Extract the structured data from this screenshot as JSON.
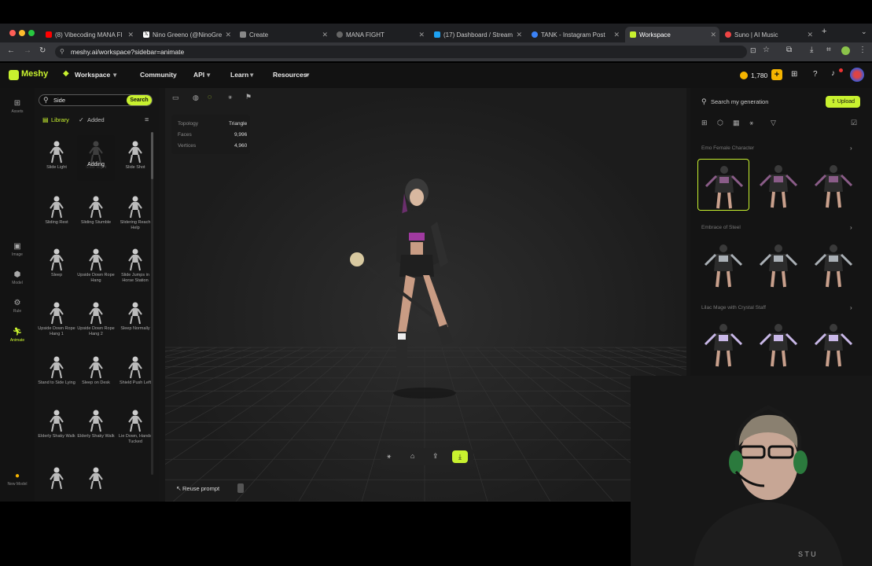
{
  "browser": {
    "tabs": [
      {
        "label": "(8) Vibecoding MANA FI"
      },
      {
        "label": "Nino Greeno (@NinoGre"
      },
      {
        "label": "Create"
      },
      {
        "label": "MANA FIGHT"
      },
      {
        "label": "(17) Dashboard / Stream"
      },
      {
        "label": "TANK - Instagram Post"
      },
      {
        "label": "Workspace"
      },
      {
        "label": "Suno | AI Music"
      }
    ],
    "new_tab": "+",
    "url": "meshy.ai/workspace?sidebar=animate"
  },
  "app": {
    "logo": "Meshy",
    "nav": {
      "workspace": "Workspace",
      "community": "Community",
      "api": "API",
      "learn": "Learn",
      "resources": "Resources"
    },
    "credits": "1,780"
  },
  "rail": {
    "assets": "Assets",
    "image": "Image",
    "model": "Model",
    "rule": "Rule",
    "animate": "Animate",
    "new_model": "New Model"
  },
  "library": {
    "search_value": "Side",
    "search_button": "Search",
    "tab_library": "Library",
    "tab_added": "Added",
    "adding_label": "Adding",
    "items": [
      {
        "label": "Slide Light"
      },
      {
        "label": "Slide Right"
      },
      {
        "label": "Slide Shot"
      },
      {
        "label": "Sliding Rest"
      },
      {
        "label": "Sliding Stumble"
      },
      {
        "label": "Slidering Reach Help"
      },
      {
        "label": "Sleep"
      },
      {
        "label": "Upside Down Rope Hang"
      },
      {
        "label": "Slide Jumps in Horse Station"
      },
      {
        "label": "Upside Down Rope Hang 1"
      },
      {
        "label": "Upside Down Rope Hang 2"
      },
      {
        "label": "Sleep Normally"
      },
      {
        "label": "Stand to Side Lying"
      },
      {
        "label": "Sleep on Desk"
      },
      {
        "label": "Shield Push Left"
      },
      {
        "label": "Elderly Shaky Walk"
      },
      {
        "label": "Elderly Shaky Walk"
      },
      {
        "label": "Lie Down, Hands Tucked"
      },
      {
        "label": ""
      },
      {
        "label": ""
      }
    ]
  },
  "viewport": {
    "stats": [
      {
        "key": "Topology",
        "value": "Triangle"
      },
      {
        "key": "Faces",
        "value": "9,996"
      },
      {
        "key": "Vertices",
        "value": "4,960"
      }
    ],
    "reuse_prompt": "Reuse prompt"
  },
  "generations": {
    "search_placeholder": "Search my generation",
    "upload": "Upload",
    "sections": [
      {
        "title": "Emo Female Character"
      },
      {
        "title": "Embrace of Steel"
      },
      {
        "title": "Lilac Mage with Crystal Staff"
      }
    ]
  },
  "colors": {
    "accent": "#c8f12f",
    "bg": "#161616",
    "credit": "#f5b400"
  }
}
